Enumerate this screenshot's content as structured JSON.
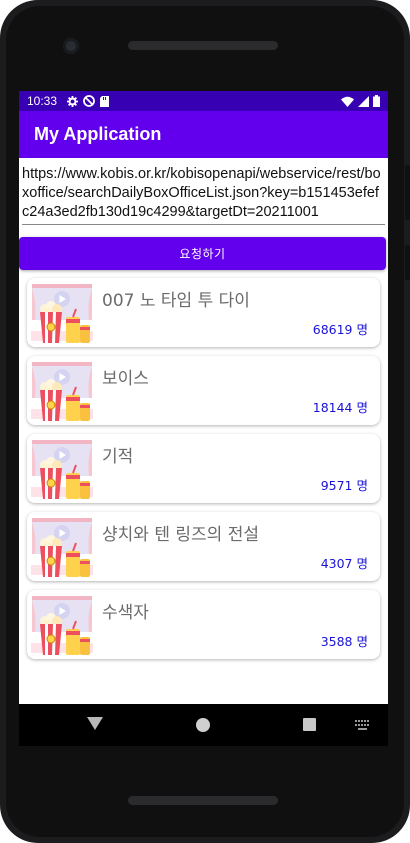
{
  "status_bar": {
    "time": "10:33",
    "icons": [
      "gear-icon",
      "vpn-icon",
      "sd-card-icon"
    ],
    "right_icons": [
      "wifi-icon",
      "signal-icon",
      "battery-icon"
    ]
  },
  "app_bar": {
    "title": "My Application"
  },
  "request": {
    "url": "https://www.kobis.or.kr/kobisopenapi/webservice/rest/boxoffice/searchDailyBoxOfficeList.json?key=b151453efefc24a3ed2fb130d19c4299&targetDt=20211001",
    "button_label": "요청하기"
  },
  "movies": [
    {
      "title": "007 노 타임 투 다이",
      "audience": "68619 명"
    },
    {
      "title": "보이스",
      "audience": "18144 명"
    },
    {
      "title": "기적",
      "audience": "9571 명"
    },
    {
      "title": "샹치와 텐 링즈의 전설",
      "audience": "4307 명"
    },
    {
      "title": "수색자",
      "audience": "3588 명"
    }
  ],
  "colors": {
    "status_bar": "#3700b3",
    "primary": "#6200ee",
    "audience_text": "#1a12d8",
    "title_text": "#6b6b6b"
  }
}
